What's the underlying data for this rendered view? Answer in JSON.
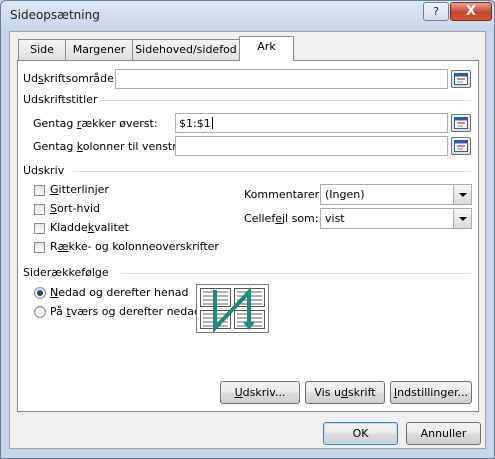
{
  "window": {
    "title": "Sideopsætning",
    "help_glyph": "?",
    "close_glyph": "X"
  },
  "tabs": [
    {
      "label": "Side",
      "active": false
    },
    {
      "label": "Margener",
      "active": false
    },
    {
      "label": "Sidehoved/sidefod",
      "active": false
    },
    {
      "label": "Ark",
      "active": true
    }
  ],
  "print_area": {
    "label_pre": "Ud",
    "label_u": "s",
    "label_post": "kriftsområde:",
    "value": ""
  },
  "print_titles": {
    "header": "Udskriftstitler",
    "rows": {
      "label_pre": "Gentag ",
      "label_u": "r",
      "label_post": "ækker øverst:",
      "value": "$1:$1"
    },
    "cols": {
      "label_pre": "Gentag ",
      "label_u": "k",
      "label_post": "olonner til venstre:",
      "value": ""
    }
  },
  "print": {
    "header": "Udskriv",
    "checkboxes": [
      {
        "u": "G",
        "post": "itterlinjer",
        "pre": ""
      },
      {
        "u": "S",
        "post": "ort-hvid",
        "pre": ""
      },
      {
        "pre": "Kladde",
        "u": "k",
        "post": "valitet"
      },
      {
        "pre": "R",
        "u": "æ",
        "post": "kke- og kolonneoverskrifter"
      }
    ],
    "comments": {
      "label_pre": "Kommentarer",
      "label_u": "",
      "label_post": ":",
      "value": "(Ingen)"
    },
    "cell_errors": {
      "label_pre": "Cellef",
      "label_u": "e",
      "label_post": "jl som:",
      "value": "vist"
    }
  },
  "page_order": {
    "header": "Siderækkefølge",
    "options": [
      {
        "pre": "",
        "u": "N",
        "post": "edad og derefter henad",
        "selected": true
      },
      {
        "pre": "På ",
        "u": "t",
        "post": "værs og derefter nedad",
        "selected": false
      }
    ]
  },
  "buttons": {
    "print": {
      "pre": "",
      "u": "U",
      "post": "dskriv..."
    },
    "preview": {
      "pre": "Vis u",
      "u": "d",
      "post": "skrift"
    },
    "options": {
      "pre": "",
      "u": "I",
      "post": "ndstillinger..."
    },
    "ok": "OK",
    "cancel": "Annuller"
  },
  "colors": {
    "accent": "#1c4a8c",
    "close_button": "#c7452b",
    "separator": "#d5dfe5"
  },
  "icons": {
    "ref_button": "collapse-dialog-icon",
    "page_order_preview": "page-order-down-then-over-icon"
  }
}
